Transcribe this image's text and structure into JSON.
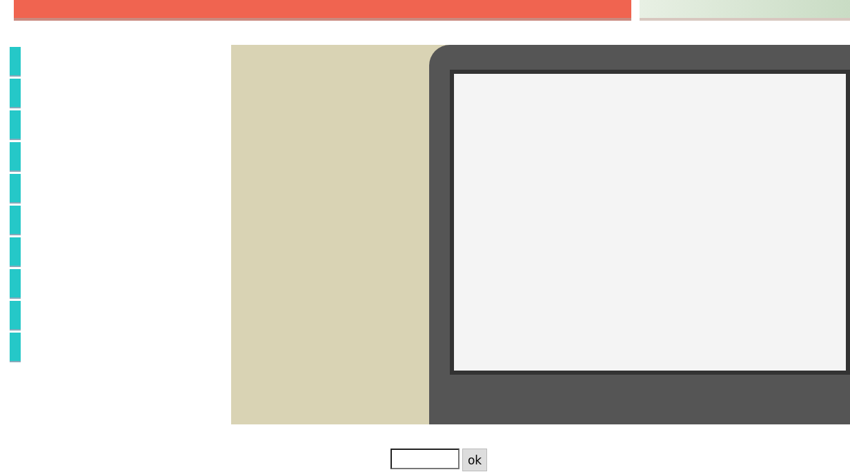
{
  "form": {
    "button": "ok"
  }
}
